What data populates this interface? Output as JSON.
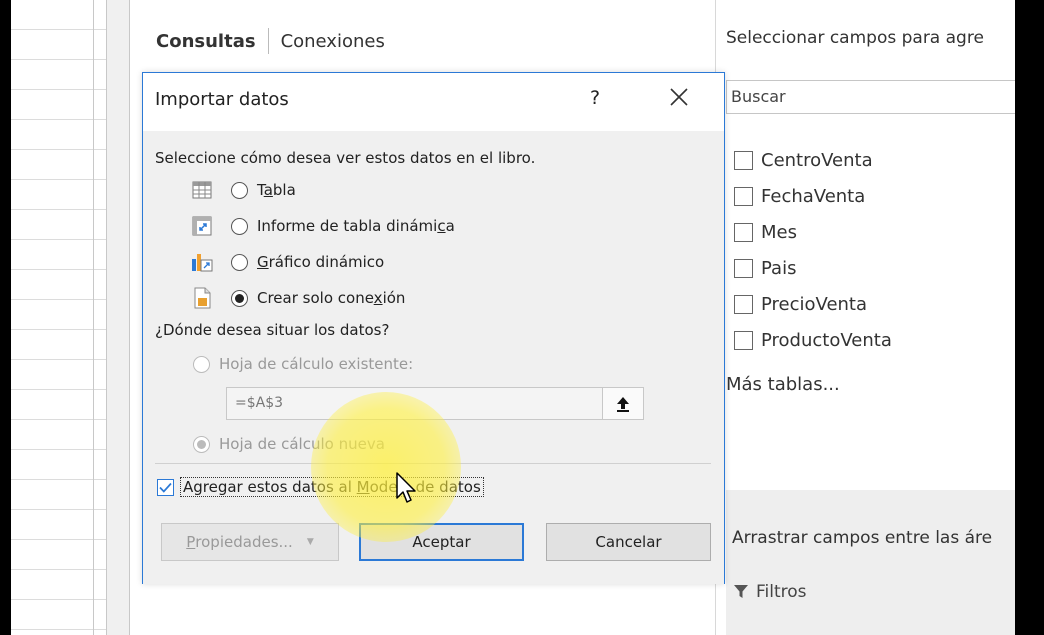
{
  "queries_pane": {
    "tab_active": "Consultas",
    "tab_other": "Conexiones"
  },
  "fields_pane": {
    "header": "Seleccionar campos para agre",
    "search_placeholder": "Buscar",
    "fields": [
      "CentroVenta",
      "FechaVenta",
      "Mes",
      "Pais",
      "PrecioVenta",
      "ProductoVenta"
    ],
    "more_tables": "Más tablas...",
    "drag_hint": "Arrastrar campos entre las áre",
    "filters_label": "Filtros"
  },
  "dialog": {
    "title": "Importar datos",
    "help": "?",
    "question_view": "Seleccione cómo desea ver estos datos en el libro.",
    "view_options": [
      {
        "pre": "T",
        "accel": "a",
        "post": "bla",
        "icon": "table-icon",
        "selected": false
      },
      {
        "pre": "Informe de tabla dinámi",
        "accel": "c",
        "post": "a",
        "icon": "pivot-table-icon",
        "selected": false
      },
      {
        "pre": "",
        "accel": "G",
        "post": "ráfico dinámico",
        "icon": "pivot-chart-icon",
        "selected": false
      },
      {
        "pre": "Crear solo cone",
        "accel": "x",
        "post": "ión",
        "icon": "connection-only-icon",
        "selected": true
      }
    ],
    "question_location": "¿Dónde desea situar los datos?",
    "location_existing": "Hoja de cálculo existente:",
    "cell_reference": "=$A$3",
    "location_new": "Hoja de cálculo nueva",
    "add_to_model": {
      "pre": "Agregar estos datos al ",
      "accel": "M",
      "post": "odelo de datos",
      "checked": true
    },
    "btn_properties": {
      "accel": "P",
      "post": "ropiedades..."
    },
    "btn_accept": "Aceptar",
    "btn_cancel": "Cancelar"
  }
}
